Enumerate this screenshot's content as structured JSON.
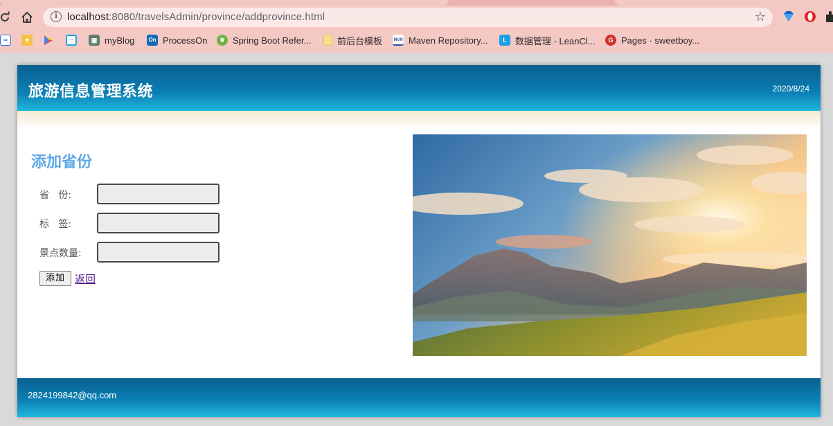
{
  "browser": {
    "url_host": "localhost",
    "url_path": ":8080/travelsAdmin/province/addprovince.html",
    "bookmarks": [
      {
        "label": "",
        "icon": "baidu-paw-icon",
        "color": "#2f6be0"
      },
      {
        "label": "",
        "icon": "bird-icon",
        "color": "#e2a33a"
      },
      {
        "label": "",
        "icon": "play-store-icon",
        "color": "#2bb24c"
      },
      {
        "label": "",
        "icon": "bilibili-icon",
        "color": "#21a3dc"
      },
      {
        "label": "myBlog",
        "icon": "blog-icon",
        "color": "#5f7f6f"
      },
      {
        "label": "ProcessOn",
        "icon": "processon-icon",
        "color": "#1169b4"
      },
      {
        "label": "Spring Boot Refer...",
        "icon": "spring-icon",
        "color": "#6db33f"
      },
      {
        "label": "前后台模板",
        "icon": "folder-icon",
        "color": "#f4d26a"
      },
      {
        "label": "Maven Repository...",
        "icon": "maven-icon",
        "color": "#2b54a3"
      },
      {
        "label": "数据管理 - LeanCl...",
        "icon": "leancloud-icon",
        "color": "#1aa0e8"
      },
      {
        "label": "Pages · sweetboy...",
        "icon": "gitee-icon",
        "color": "#d0312d"
      }
    ],
    "info_glyph": "i"
  },
  "header": {
    "title": "旅游信息管理系统",
    "date": "2020/8/24"
  },
  "form": {
    "heading": "添加省份",
    "fields": [
      {
        "label": "省   份:",
        "value": ""
      },
      {
        "label": "标   签:",
        "value": ""
      },
      {
        "label": "景点数量:",
        "value": ""
      }
    ],
    "submit_label": "添加",
    "back_label": "返回"
  },
  "footer": {
    "email": "2824199842@qq.com"
  },
  "colors": {
    "header_blue": "#0b7fb3",
    "heading_blue": "#5fa8e8",
    "link_visited": "#551a8b"
  }
}
